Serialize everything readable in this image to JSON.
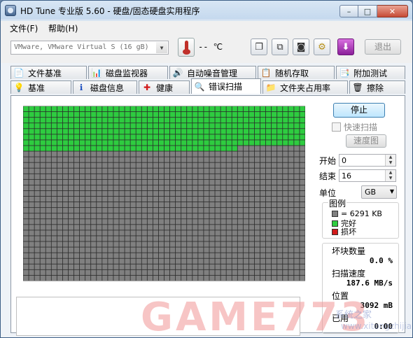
{
  "titlebar": {
    "title": "HD Tune 专业版 5.60 - 硬盘/固态硬盘实用程序"
  },
  "window_buttons": {
    "minimize": "–",
    "maximize": "□",
    "close": "✕"
  },
  "menu": {
    "items": [
      "文件(F)",
      "帮助(H)"
    ]
  },
  "toolbar": {
    "drive": "VMware, VMware Virtual S (16 gB)",
    "temperature": "-- ℃",
    "exit_label": "退出"
  },
  "tabs_top": [
    {
      "label": "文件基准",
      "icon": "file-benchmark-icon",
      "glyph": "📄"
    },
    {
      "label": "磁盘监视器",
      "icon": "disk-monitor-icon",
      "glyph": "📊"
    },
    {
      "label": "自动噪音管理",
      "icon": "speaker-icon",
      "glyph": "🔊"
    },
    {
      "label": "随机存取",
      "icon": "random-access-icon",
      "glyph": "📋"
    },
    {
      "label": "附加测试",
      "icon": "extra-tests-icon",
      "glyph": "📑"
    }
  ],
  "tabs_bottom": [
    {
      "label": "基准",
      "icon": "lightbulb-icon",
      "glyph": "💡"
    },
    {
      "label": "磁盘信息",
      "icon": "info-icon",
      "glyph": "ℹ"
    },
    {
      "label": "健康",
      "icon": "health-cross-icon",
      "glyph": "✚"
    },
    {
      "label": "错误扫描",
      "icon": "magnifier-icon",
      "glyph": "🔍",
      "active": true
    },
    {
      "label": "文件夹占用率",
      "icon": "folder-icon",
      "glyph": "📁"
    },
    {
      "label": "擦除",
      "icon": "trash-icon",
      "glyph": "🗑"
    }
  ],
  "scan": {
    "stop_label": "停止",
    "quick_scan_label": "快速扫描",
    "speed_map_label": "速度图",
    "start_label": "开始",
    "start_value": "0",
    "end_label": "结束",
    "end_value": "16",
    "unit_label": "单位",
    "unit_value": "GB",
    "progress_rows_complete_fraction": 0.25,
    "colors": {
      "ok": "#2ecc40",
      "unscanned": "#808080",
      "bad": "#d11a1a"
    }
  },
  "legend": {
    "title": "图例",
    "block_size": "= 6291 KB",
    "ok_label": "完好",
    "bad_label": "损坏"
  },
  "stats": {
    "bad_blocks_label": "坏块数量",
    "bad_blocks_value": "0.0 %",
    "scan_speed_label": "扫描速度",
    "scan_speed_value": "187.6 MB/s",
    "position_label": "位置",
    "position_value": "3092 mB",
    "elapsed_label": "已用",
    "elapsed_value": "0:00"
  },
  "watermark": {
    "main": "GAME773",
    "site": "系统之家",
    "url": "www.xitongzhijia"
  }
}
